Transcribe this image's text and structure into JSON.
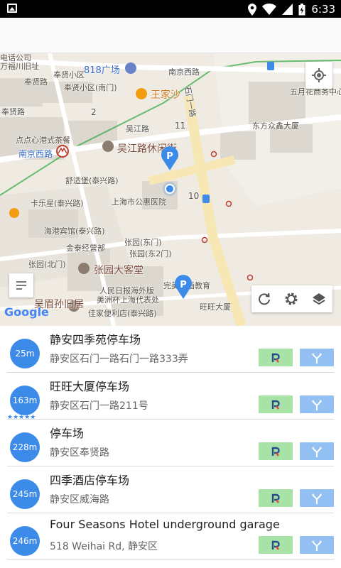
{
  "status_bar": {
    "time": "6:33"
  },
  "map": {
    "labels": {
      "l1": "电话公司",
      "l2": "万福川旧址",
      "l3": "奉贤路",
      "l4": "奉贤小区",
      "l5": "奉贤小区(南门)",
      "l6": "818广场",
      "l7": "南京西路",
      "l8": "五月花商务中心",
      "l9": "王家沙",
      "l10": "东方众鑫大厦",
      "l11": "吴江路",
      "l12": "点点心港式茶餐",
      "l13": "南京西路",
      "l14": "吴江路休闲街",
      "l15": "舒适堡(泰兴路)",
      "l16": "上海市公惠医院",
      "l17": "卡乐星(泰兴路)",
      "l18": "海港宾馆(泰兴路)",
      "l19": "张园(东门)",
      "l20": "金泰经营部",
      "l21": "张园(东2门)",
      "l22": "张园(北门)",
      "l23": "张园大客堂",
      "l24": "人民日报海外版",
      "l25": "美洲杯上海代表处",
      "l26": "吴眉孙旧居",
      "l27": "佳家便利店(泰兴路)",
      "l28": "完美动画教育",
      "l29": "旺旺大厦",
      "l30": "奉贤路",
      "l31": "石门一路",
      "n1": "2",
      "n2": "11",
      "n3": "10",
      "google": "Google"
    }
  },
  "parking": [
    {
      "distance": "25m",
      "name": "静安四季苑停车场",
      "address": "静安区石门一路石门一路333弄",
      "stars": ""
    },
    {
      "distance": "163m",
      "name": "旺旺大厦停车场",
      "address": "静安区石门一路211号",
      "stars": "★★★★★"
    },
    {
      "distance": "228m",
      "name": "停车场",
      "address": "静安区奉贤路",
      "stars": ""
    },
    {
      "distance": "245m",
      "name": "四季酒店停车场",
      "address": "静安区威海路",
      "stars": ""
    },
    {
      "distance": "246m",
      "name": "Four Seasons Hotel underground garage",
      "address": "518 Weihai Rd, 静安区",
      "stars": ""
    }
  ],
  "colors": {
    "accent": "#3d8be8",
    "park_btn": "#a7e3a6",
    "nav_btn": "#93c0f2"
  },
  "icons": [
    "image-icon",
    "location-icon",
    "wifi-icon",
    "signal-icon",
    "battery-icon",
    "my-location-icon",
    "refresh-icon",
    "gear-icon",
    "layers-icon",
    "list-icon",
    "parking-pin-icon",
    "parking-logo-icon",
    "navigate-icon"
  ]
}
